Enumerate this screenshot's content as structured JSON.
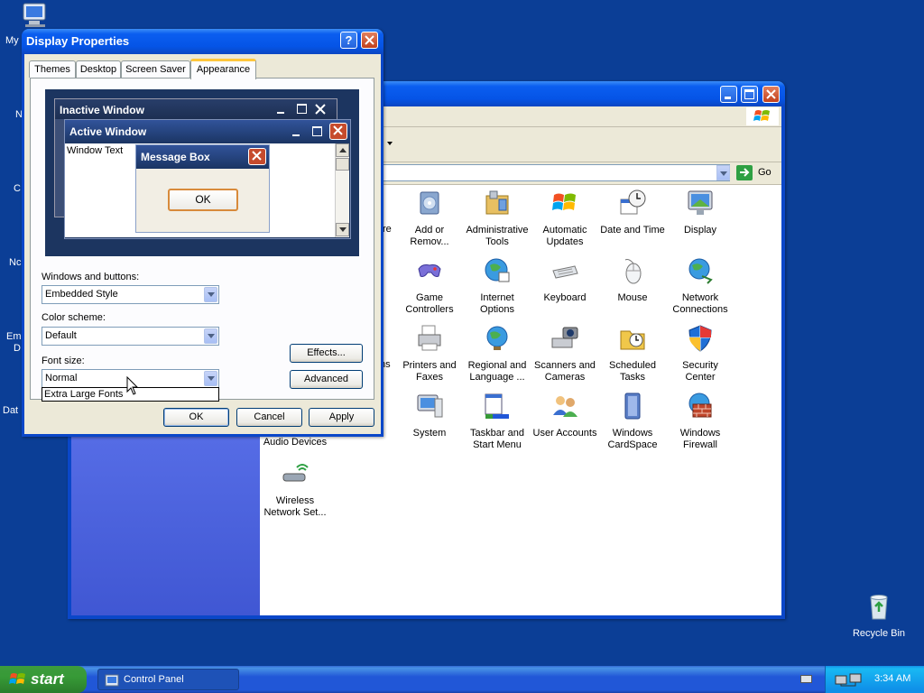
{
  "desktop": {
    "partial_labels": [
      "My",
      "N",
      "C",
      "Nc",
      "Em",
      "D",
      "Dat"
    ],
    "recycle_bin": "Recycle Bin"
  },
  "control_panel": {
    "partial_texts": [
      "re",
      "ns"
    ],
    "address_go": "Go",
    "items": [
      {
        "label": "Add or\nRemov...",
        "icon": "add-remove-programs-icon"
      },
      {
        "label": "Administrative\nTools",
        "icon": "administrative-tools-icon"
      },
      {
        "label": "Automatic\nUpdates",
        "icon": "automatic-updates-icon"
      },
      {
        "label": "Date and Time",
        "icon": "date-time-icon"
      },
      {
        "label": "Display",
        "icon": "display-icon",
        "selected": true
      },
      {
        "label": "Game\nControllers",
        "icon": "game-controllers-icon"
      },
      {
        "label": "Internet\nOptions",
        "icon": "internet-options-icon"
      },
      {
        "label": "Keyboard",
        "icon": "keyboard-icon"
      },
      {
        "label": "Mouse",
        "icon": "mouse-icon"
      },
      {
        "label": "Network\nConnections",
        "icon": "network-connections-icon"
      },
      {
        "label": "Printers and\nFaxes",
        "icon": "printers-faxes-icon"
      },
      {
        "label": "Regional and\nLanguage ...",
        "icon": "regional-language-icon"
      },
      {
        "label": "Scanners and\nCameras",
        "icon": "scanners-cameras-icon"
      },
      {
        "label": "Scheduled\nTasks",
        "icon": "scheduled-tasks-icon"
      },
      {
        "label": "Security\nCenter",
        "icon": "security-center-icon"
      },
      {
        "label": "System",
        "icon": "system-icon"
      },
      {
        "label": "Taskbar and\nStart Menu",
        "icon": "taskbar-start-menu-icon"
      },
      {
        "label": "User Accounts",
        "icon": "user-accounts-icon"
      },
      {
        "label": "Windows\nCardSpace",
        "icon": "windows-cardspace-icon"
      },
      {
        "label": "Windows\nFirewall",
        "icon": "windows-firewall-icon"
      },
      {
        "label": "Audio Devices",
        "icon": "audio-devices-icon"
      },
      {
        "label": "Wireless\nNetwork Set...",
        "icon": "wireless-network-icon"
      }
    ]
  },
  "display_properties": {
    "title": "Display Properties",
    "tabs": [
      "Themes",
      "Desktop",
      "Screen Saver",
      "Appearance"
    ],
    "active_tab": "Appearance",
    "preview": {
      "inactive_title": "Inactive Window",
      "active_title": "Active Window",
      "window_text": "Window Text",
      "message_box_title": "Message Box",
      "message_box_ok": "OK"
    },
    "windows_buttons_label": "Windows and buttons:",
    "windows_buttons_value": "Embedded Style",
    "color_scheme_label": "Color scheme:",
    "color_scheme_value": "Default",
    "font_size_label": "Font size:",
    "font_size_value": "Normal",
    "font_size_dropdown_option": "Extra Large Fonts",
    "effects_button": "Effects...",
    "advanced_button": "Advanced",
    "ok_button": "OK",
    "cancel_button": "Cancel",
    "apply_button": "Apply"
  },
  "taskbar": {
    "start_label": "start",
    "task_button": "Control Panel",
    "clock": "3:34 AM"
  }
}
